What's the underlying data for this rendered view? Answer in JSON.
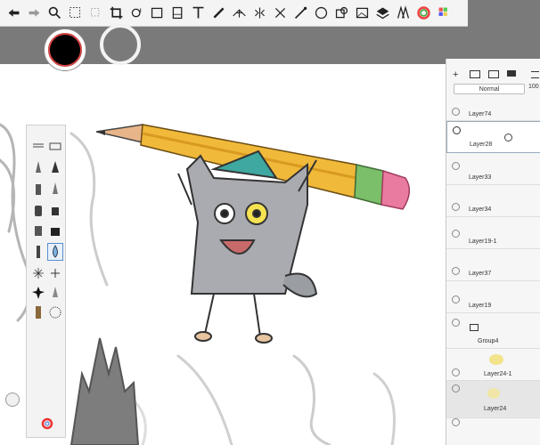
{
  "toolbar": {
    "icons": [
      "undo-icon",
      "redo-icon",
      "zoom-icon",
      "select-icon",
      "lasso-icon",
      "crop-icon",
      "transform-icon",
      "distort-icon",
      "symmetry-icon",
      "text-icon",
      "ruler-icon",
      "perspective-icon",
      "mirror-icon",
      "x-symmetry-icon",
      "pen-icon",
      "ellipse-icon",
      "shape-icon",
      "image-icon",
      "layer-icon",
      "fill-icon",
      "color-wheel-icon",
      "grid-icon"
    ]
  },
  "colors": {
    "primary": "#000000",
    "secondary": "#7a7a7a"
  },
  "layers_panel": {
    "blend_mode": "Normal",
    "opacity": "100",
    "layers": [
      {
        "name": "Layer74",
        "selected": false
      },
      {
        "name": "Layer28",
        "selected": true
      },
      {
        "name": "Layer33",
        "selected": false
      },
      {
        "name": "Layer34",
        "selected": false
      },
      {
        "name": "Layer19-1",
        "selected": false
      },
      {
        "name": "Layer37",
        "selected": false
      },
      {
        "name": "Layer19",
        "selected": false
      },
      {
        "name": "Group4",
        "selected": false
      },
      {
        "name": "Layer24-1",
        "selected": false
      },
      {
        "name": "Layer24",
        "selected": false
      }
    ]
  }
}
